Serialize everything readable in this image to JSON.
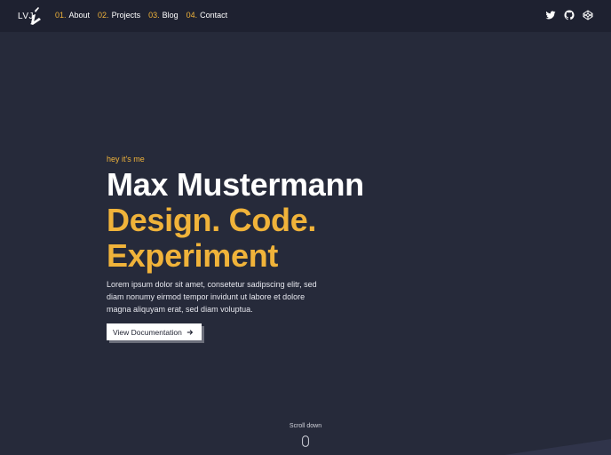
{
  "header": {
    "logo_text": "LVJ",
    "menu": [
      {
        "num": "01.",
        "label": "About"
      },
      {
        "num": "02.",
        "label": "Projects"
      },
      {
        "num": "03.",
        "label": "Blog"
      },
      {
        "num": "04.",
        "label": "Contact"
      }
    ],
    "social_icons": [
      "twitter-icon",
      "github-icon",
      "codepen-icon"
    ]
  },
  "hero": {
    "greeting": "hey it's me",
    "name": "Max Mustermann",
    "tagline_line1": "Design. Code.",
    "tagline_line2": "Experiment",
    "description": "Lorem ipsum dolor sit amet, consetetur sadipscing elitr, sed diam nonumy eirmod tempor invidunt ut labore et dolore magna aliquyam erat, sed diam voluptua.",
    "cta_label": "View Documentation"
  },
  "scroll": {
    "label": "Scroll down"
  },
  "colors": {
    "background": "#262a3a",
    "header": "#1e2130",
    "accent": "#f0b33a",
    "text": "#ffffff"
  }
}
